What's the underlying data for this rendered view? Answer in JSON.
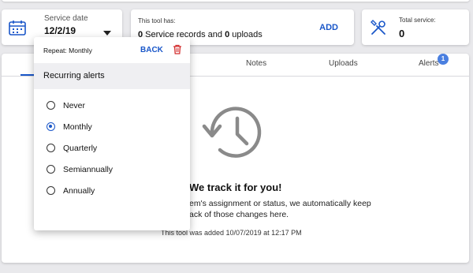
{
  "service_date": {
    "label": "Service date",
    "value": "12/2/19",
    "icon": "calendar-icon"
  },
  "tool_has": {
    "label": "This tool has:",
    "records_count": "0",
    "records_text": " Service records and ",
    "uploads_count": "0",
    "uploads_text": " uploads",
    "add_label": "ADD"
  },
  "total_service": {
    "label": "Total service:",
    "value": "0",
    "icon": "tools-icon"
  },
  "tabs": [
    {
      "label": "Notes"
    },
    {
      "label": "Uploads"
    },
    {
      "label": "Alerts",
      "badge": "1"
    }
  ],
  "empty_state": {
    "icon": "history-icon",
    "title": "We track it for you!",
    "line1": "em's assignment or status, we automatically keep",
    "line2": "ack of those changes here.",
    "added": "This tool was added 10/07/2019 at 12:17 PM"
  },
  "popup": {
    "repeat_label": "Repeat: Monthly",
    "back_label": "BACK",
    "header": "Recurring alerts",
    "options": [
      {
        "label": "Never",
        "selected": false
      },
      {
        "label": "Monthly",
        "selected": true
      },
      {
        "label": "Quarterly",
        "selected": false
      },
      {
        "label": "Semiannually",
        "selected": false
      },
      {
        "label": "Annually",
        "selected": false
      }
    ]
  },
  "colors": {
    "accent": "#1a57c9",
    "delete": "#d32f2f",
    "badge": "#4a7fe0"
  }
}
